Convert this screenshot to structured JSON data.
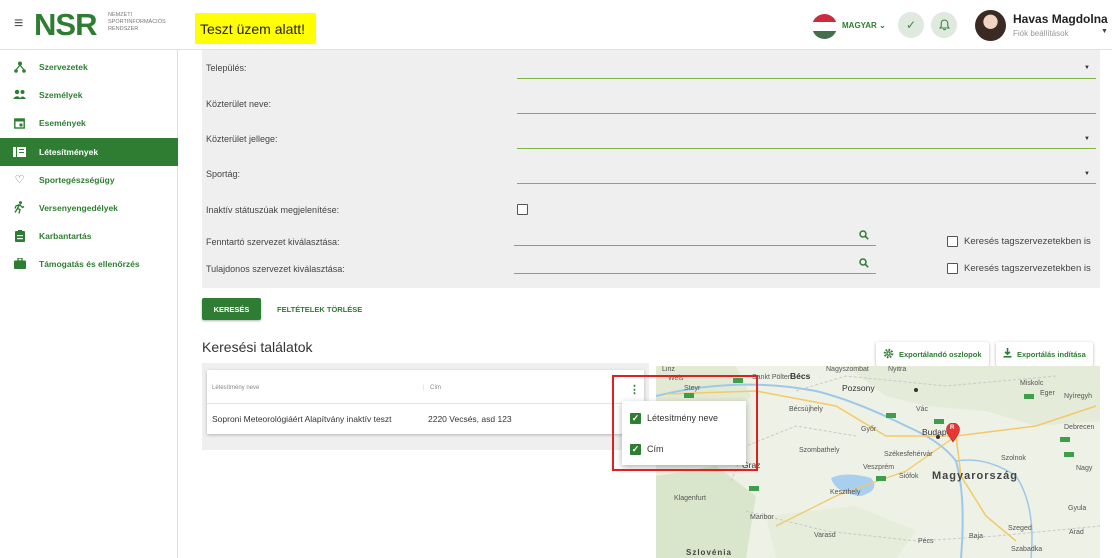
{
  "header": {
    "menu_icon": "hamburger-icon",
    "logo_text": "NSR",
    "logo_sub": [
      "NEMZETI",
      "SPORTINFORMÁCIÓS",
      "RENDSZER"
    ],
    "test_banner": "Teszt üzem alatt!",
    "language": "MAGYAR",
    "user_name": "Havas Magdolna",
    "user_sub": "Fiók beállítások",
    "colors": {
      "brand": "#2e7d32",
      "banner": "#ffff00",
      "flag": [
        "#cd2a3e",
        "#ffffff",
        "#436f4d"
      ]
    }
  },
  "sidebar": {
    "items": [
      {
        "label": "Szervezetek",
        "icon": "org-tree-icon"
      },
      {
        "label": "Személyek",
        "icon": "people-icon"
      },
      {
        "label": "Események",
        "icon": "calendar-icon"
      },
      {
        "label": "Létesítmények",
        "icon": "building-icon",
        "active": true
      },
      {
        "label": "Sportegészségügy",
        "icon": "heart-icon"
      },
      {
        "label": "Versenyengedélyek",
        "icon": "runner-icon"
      },
      {
        "label": "Karbantartás",
        "icon": "clipboard-icon"
      },
      {
        "label": "Támogatás és ellenőrzés",
        "icon": "briefcase-icon"
      }
    ]
  },
  "form": {
    "telepules": "Település:",
    "kozterulet_neve": "Közterület neve:",
    "kozterulet_jellege": "Közterület jellege:",
    "sportag": "Sportág:",
    "inaktiv": "Inaktív státuszúak megjelenítése:",
    "fenntarto": "Fenntartó szervezet kiválasztása:",
    "tulajdonos": "Tulajdonos szervezet kiválasztása:",
    "tagszervezet": "Keresés tagszervezetekben is"
  },
  "actions": {
    "search": "KERESÉS",
    "clear": "FELTÉTELEK TÖRLÉSE"
  },
  "results": {
    "title": "Keresési találatok",
    "export_columns": "Exportálandó oszlopok",
    "export_start": "Exportálás indítása",
    "columns": [
      "Létesítmény neve",
      "Cím"
    ],
    "rows": [
      {
        "name": "Soproni Meteorológiáért Alapítvány inaktív teszt",
        "address": "2220 Vecsés, asd 123"
      }
    ]
  },
  "column_menu": {
    "items": [
      {
        "label": "Létesítmény neve",
        "checked": true
      },
      {
        "label": "Cím",
        "checked": true
      }
    ]
  },
  "map": {
    "labels": [
      "Linz",
      "Wels",
      "Steyr",
      "Sankt Pölten",
      "Bécs",
      "Nagyszombat",
      "Nyitra",
      "Pozsony",
      "Miskolc",
      "Eger",
      "Nyíregyh",
      "Vác",
      "Budapest",
      "Debrecen",
      "Győr",
      "Bécsújhely",
      "Szombathely",
      "Székesfehérvár",
      "Veszprém",
      "Siófok",
      "Szolnok",
      "Nagy",
      "Magyarország",
      "Keszthely",
      "Graz",
      "Klagenfurt",
      "Maribor",
      "Varasd",
      "Gyula",
      "Szeged",
      "Arad",
      "Pécs",
      "Baja",
      "Szabadka",
      "Szlovénia"
    ],
    "marker_label": "R"
  }
}
